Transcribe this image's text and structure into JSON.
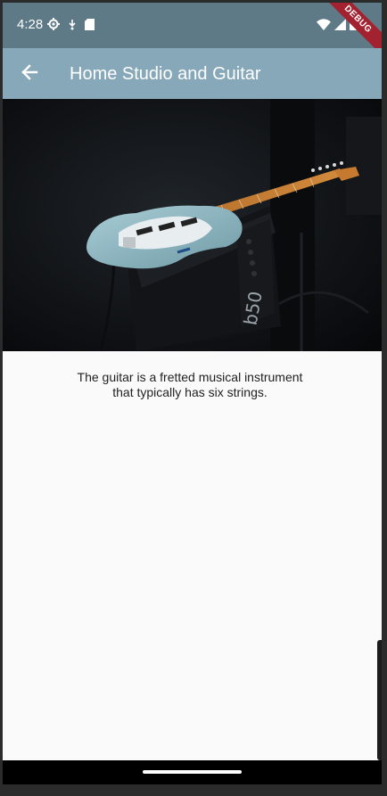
{
  "status_bar": {
    "time": "4:28",
    "icons_left": [
      "settings-gear-icon",
      "download-icon",
      "sd-card-icon"
    ],
    "icons_right": [
      "wifi-icon",
      "signal-icon",
      "battery-icon"
    ],
    "debug_label": "DEBUG"
  },
  "app_bar": {
    "title": "Home Studio and Guitar",
    "back_icon": "arrow-back-icon",
    "color": "#86a8b8"
  },
  "hero_image": {
    "subject": "electric guitar on amplifier"
  },
  "content": {
    "description": "The guitar is a fretted musical instrument\nthat typically has six strings."
  },
  "colors": {
    "status_bar": "#5e7a87",
    "app_bar": "#86a8b8",
    "background": "#fafafa",
    "debug_banner": "#a32230"
  }
}
